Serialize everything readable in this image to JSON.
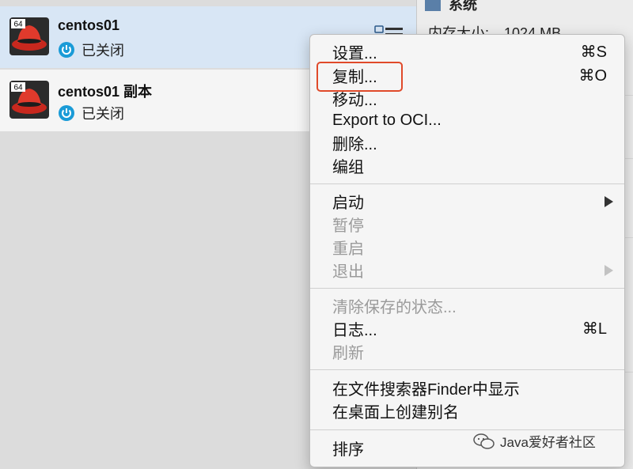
{
  "vm_list": [
    {
      "name": "centos01",
      "state": "已关闭",
      "badge": "64",
      "selected": true
    },
    {
      "name": "centos01 副本",
      "state": "已关闭",
      "badge": "64",
      "selected": false
    }
  ],
  "details": {
    "section_title": "系统",
    "memory_label": "内存大小:",
    "memory_value": "1024 MB"
  },
  "context_menu": {
    "items": [
      {
        "label": "设置...",
        "shortcut": "⌘S",
        "enabled": true
      },
      {
        "label": "复制...",
        "shortcut": "⌘O",
        "enabled": true,
        "highlighted": true
      },
      {
        "label": "移动...",
        "enabled": true
      },
      {
        "label": "Export to OCI...",
        "enabled": true
      },
      {
        "label": "删除...",
        "enabled": true
      },
      {
        "label": "编组",
        "enabled": true
      },
      {
        "label": "启动",
        "enabled": true,
        "submenu": true
      },
      {
        "label": "暂停",
        "enabled": false
      },
      {
        "label": "重启",
        "enabled": false
      },
      {
        "label": "退出",
        "enabled": false,
        "submenu": true
      },
      {
        "label": "清除保存的状态...",
        "enabled": false
      },
      {
        "label": "日志...",
        "shortcut": "⌘L",
        "enabled": true
      },
      {
        "label": "刷新",
        "enabled": false
      },
      {
        "label": "在文件搜索器Finder中显示",
        "enabled": true
      },
      {
        "label": "在桌面上创建别名",
        "enabled": true
      },
      {
        "label": "排序",
        "enabled": true
      }
    ]
  },
  "watermark": {
    "text": "Java爱好者社区",
    "icon": "wechat-icon"
  },
  "colors": {
    "highlight_border": "#e04a2a",
    "selected_row": "#d8e6f5",
    "power_icon": "#1a9bd7"
  }
}
